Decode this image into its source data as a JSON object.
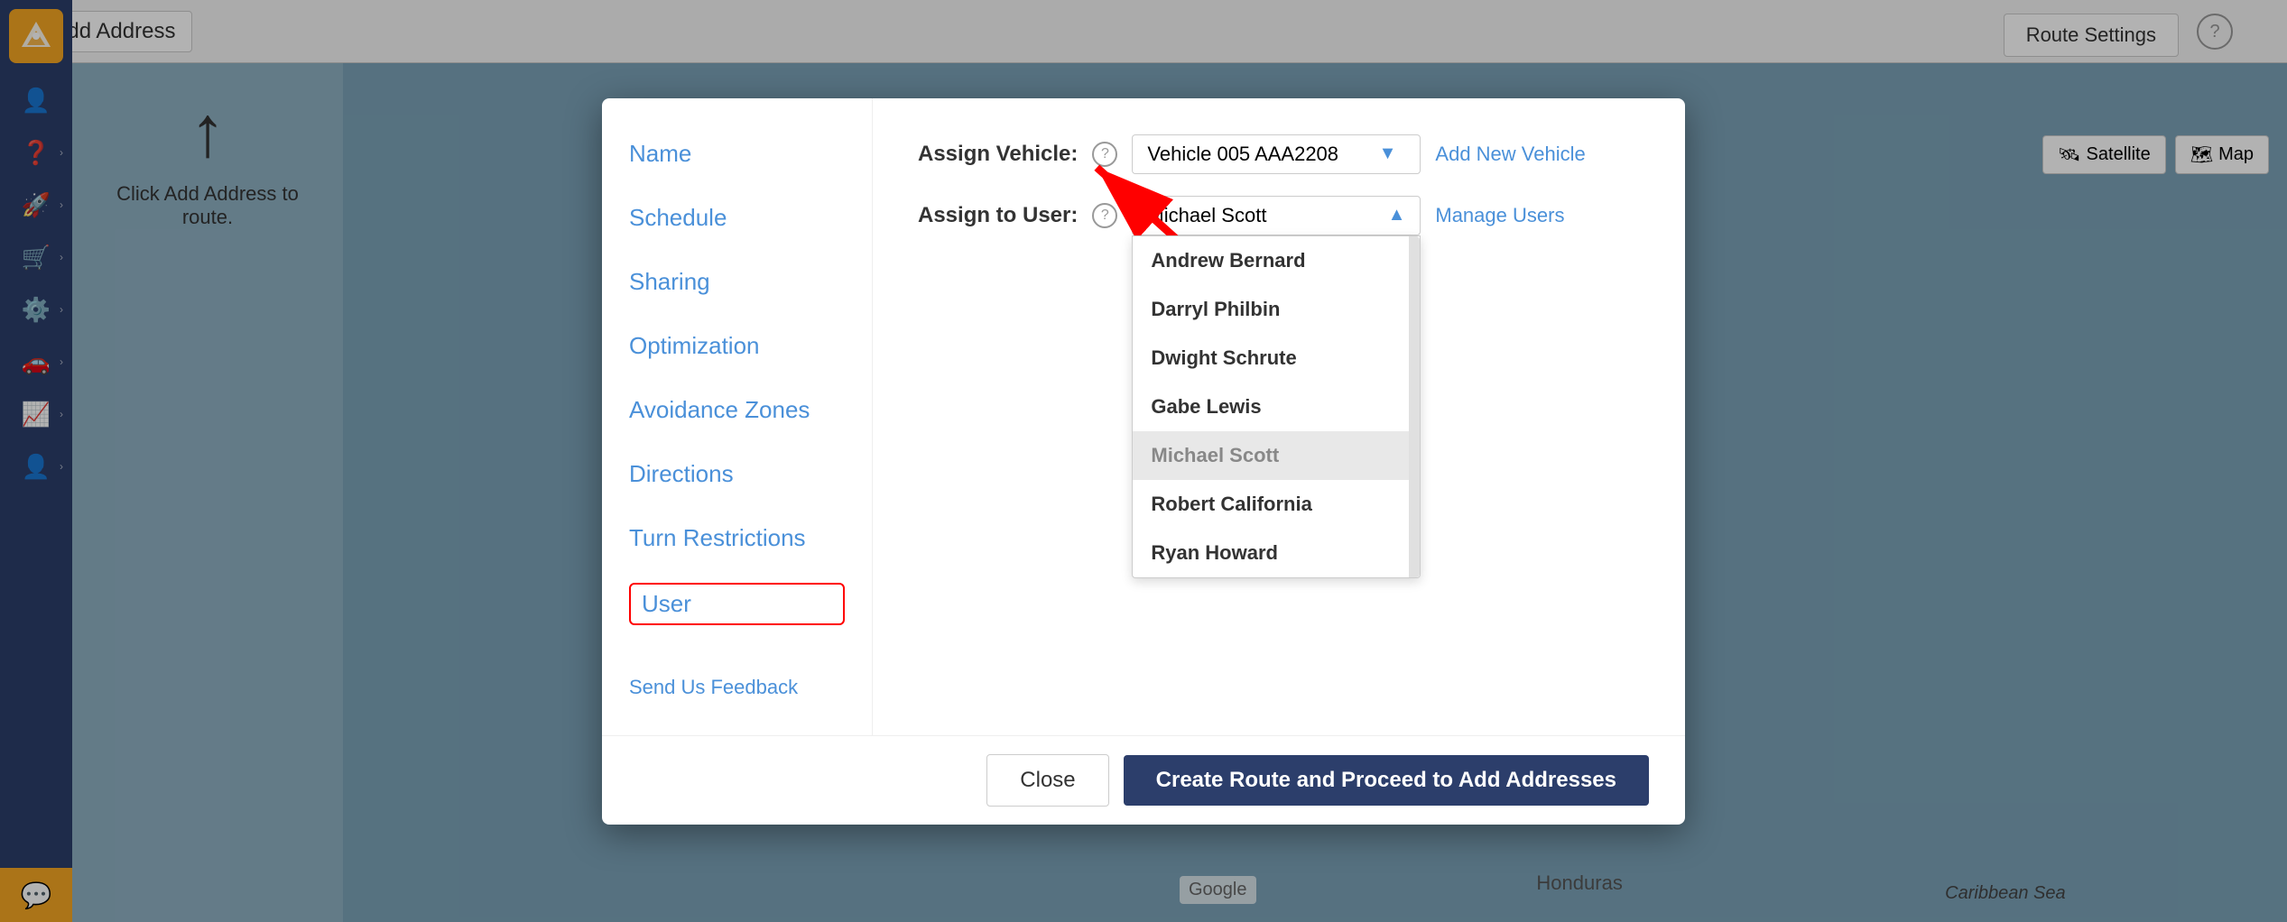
{
  "topbar": {
    "add_address_label": "+ Add Address",
    "route_settings_label": "Route Settings",
    "help_icon": "?"
  },
  "map_view": {
    "satellite_label": "Satellite",
    "map_label": "Map"
  },
  "map_labels": {
    "google": "Google",
    "honduras": "Honduras",
    "caribbean": "Caribbean Sea"
  },
  "left_panel": {
    "click_text": "Click Add Address to route."
  },
  "modal": {
    "nav_items": [
      {
        "id": "name",
        "label": "Name",
        "active": false
      },
      {
        "id": "schedule",
        "label": "Schedule",
        "active": false
      },
      {
        "id": "sharing",
        "label": "Sharing",
        "active": false
      },
      {
        "id": "optimization",
        "label": "Optimization",
        "active": false
      },
      {
        "id": "avoidance-zones",
        "label": "Avoidance Zones",
        "active": false
      },
      {
        "id": "directions",
        "label": "Directions",
        "active": false
      },
      {
        "id": "turn-restrictions",
        "label": "Turn Restrictions",
        "active": false
      },
      {
        "id": "user",
        "label": "User",
        "active": true
      }
    ],
    "feedback_label": "Send Us Feedback",
    "vehicle_label": "Assign Vehicle:",
    "vehicle_help": "?",
    "vehicle_selected": "Vehicle 005 AAA2208",
    "vehicle_arrow": "▼",
    "add_vehicle_label": "Add New Vehicle",
    "user_label": "Assign to User:",
    "user_help": "?",
    "user_selected": "Michael Scott",
    "user_arrow": "▲",
    "manage_users_label": "Manage Users",
    "users_list": [
      {
        "name": "Andrew Bernard",
        "selected": false
      },
      {
        "name": "Darryl Philbin",
        "selected": false
      },
      {
        "name": "Dwight Schrute",
        "selected": false
      },
      {
        "name": "Gabe Lewis",
        "selected": false
      },
      {
        "name": "Michael Scott",
        "selected": true
      },
      {
        "name": "Robert California",
        "selected": false
      },
      {
        "name": "Ryan Howard",
        "selected": false
      }
    ],
    "close_label": "Close",
    "create_label": "Create Route and Proceed to Add Addresses"
  },
  "sidebar": {
    "items": [
      {
        "icon": "👤",
        "label": "drivers",
        "has_chevron": false
      },
      {
        "icon": "❓",
        "label": "help",
        "has_chevron": true
      },
      {
        "icon": "🚀",
        "label": "routes",
        "has_chevron": true
      },
      {
        "icon": "🛒",
        "label": "orders",
        "has_chevron": true
      },
      {
        "icon": "⚙️",
        "label": "settings-cog",
        "has_chevron": true
      },
      {
        "icon": "🚗",
        "label": "vehicles",
        "has_chevron": true
      },
      {
        "icon": "📈",
        "label": "reports",
        "has_chevron": true
      },
      {
        "icon": "👤",
        "label": "users-admin",
        "has_chevron": true
      }
    ],
    "chat_icon": "💬"
  }
}
